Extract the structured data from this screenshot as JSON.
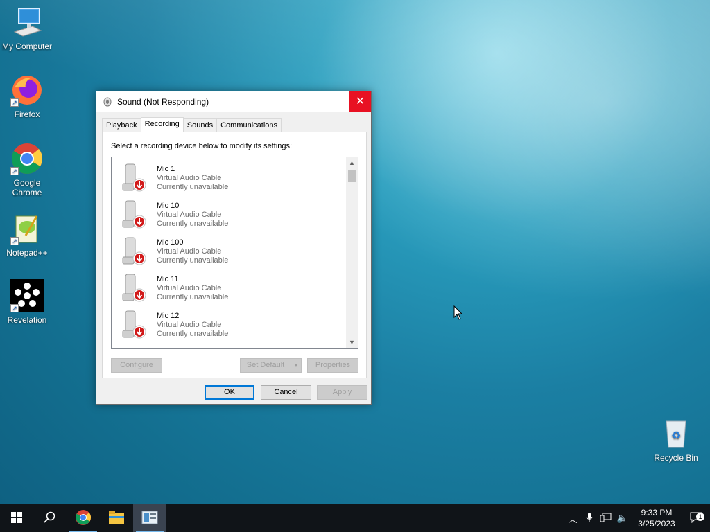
{
  "desktop": {
    "icons": [
      {
        "label": "My Computer",
        "icon": "computer-icon"
      },
      {
        "label": "Firefox",
        "icon": "firefox-icon"
      },
      {
        "label": "Google Chrome",
        "icon": "chrome-icon"
      },
      {
        "label": "Notepad++",
        "icon": "notepadpp-icon"
      },
      {
        "label": "Revelation",
        "icon": "revelation-icon"
      }
    ],
    "recycle_bin": {
      "label": "Recycle Bin",
      "icon": "recycle-bin-icon"
    }
  },
  "dialog": {
    "title": "Sound (Not Responding)",
    "close_label": "✕",
    "tabs": [
      {
        "label": "Playback",
        "active": false
      },
      {
        "label": "Recording",
        "active": true
      },
      {
        "label": "Sounds",
        "active": false
      },
      {
        "label": "Communications",
        "active": false
      }
    ],
    "instruction": "Select a recording device below to modify its settings:",
    "devices": [
      {
        "name": "Mic 1",
        "driver": "Virtual Audio Cable",
        "status": "Currently unavailable"
      },
      {
        "name": "Mic 10",
        "driver": "Virtual Audio Cable",
        "status": "Currently unavailable"
      },
      {
        "name": "Mic 100",
        "driver": "Virtual Audio Cable",
        "status": "Currently unavailable"
      },
      {
        "name": "Mic 11",
        "driver": "Virtual Audio Cable",
        "status": "Currently unavailable"
      },
      {
        "name": "Mic 12",
        "driver": "Virtual Audio Cable",
        "status": "Currently unavailable"
      }
    ],
    "buttons": {
      "configure": "Configure",
      "set_default": "Set Default",
      "properties": "Properties",
      "ok": "OK",
      "cancel": "Cancel",
      "apply": "Apply"
    }
  },
  "taskbar": {
    "apps": [
      "start-icon",
      "search-icon",
      "chrome-icon",
      "file-explorer-icon",
      "sound-settings-icon"
    ],
    "clock": {
      "time": "9:33 PM",
      "date": "3/25/2023"
    },
    "notification_count": "1"
  },
  "colors": {
    "close_red": "#e81123",
    "accent": "#0078d7",
    "unavailable_red": "#d11a1a"
  }
}
